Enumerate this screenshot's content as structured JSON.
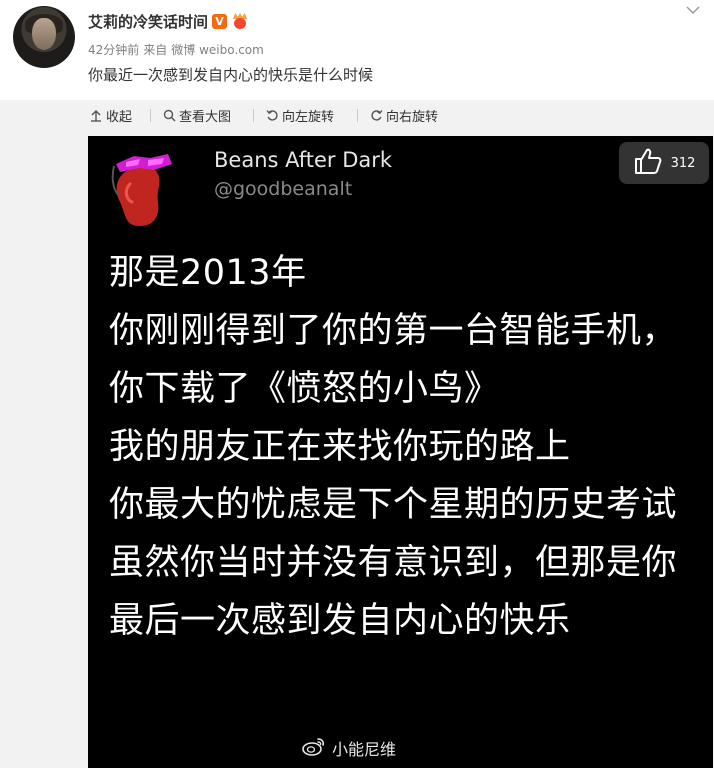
{
  "post": {
    "author": "艾莉的冷笑话时间",
    "verified_badge": "V",
    "time": "42分钟前",
    "source_prefix": "来自",
    "source": "微博 weibo.com",
    "text": "你最近一次感到发自内心的快乐是什么时候"
  },
  "toolbar": {
    "collapse": "收起",
    "view_large": "查看大图",
    "rotate_left": "向左旋转",
    "rotate_right": "向右旋转"
  },
  "tweet": {
    "author_name": "Beans After Dark",
    "author_handle": "@goodbeanalt",
    "lines": [
      "那是2013年",
      "你刚刚得到了你的第一台智能手机，",
      "你下载了《愤怒的小鸟》",
      "我的朋友正在来找你玩的路上",
      "你最大的忧虑是下个星期的历史考试",
      "虽然你当时并没有意识到，但那是你",
      "最后一次感到发自内心的快乐"
    ]
  },
  "like": {
    "count": "312",
    "icon": "thumbs-up-icon"
  },
  "watermark": {
    "text": "小能尼维",
    "icon": "weibo-logo-icon"
  },
  "colors": {
    "badge": "#f26b11",
    "toolbar_bg": "#f2f2f2",
    "tweet_bg": "#000000"
  }
}
